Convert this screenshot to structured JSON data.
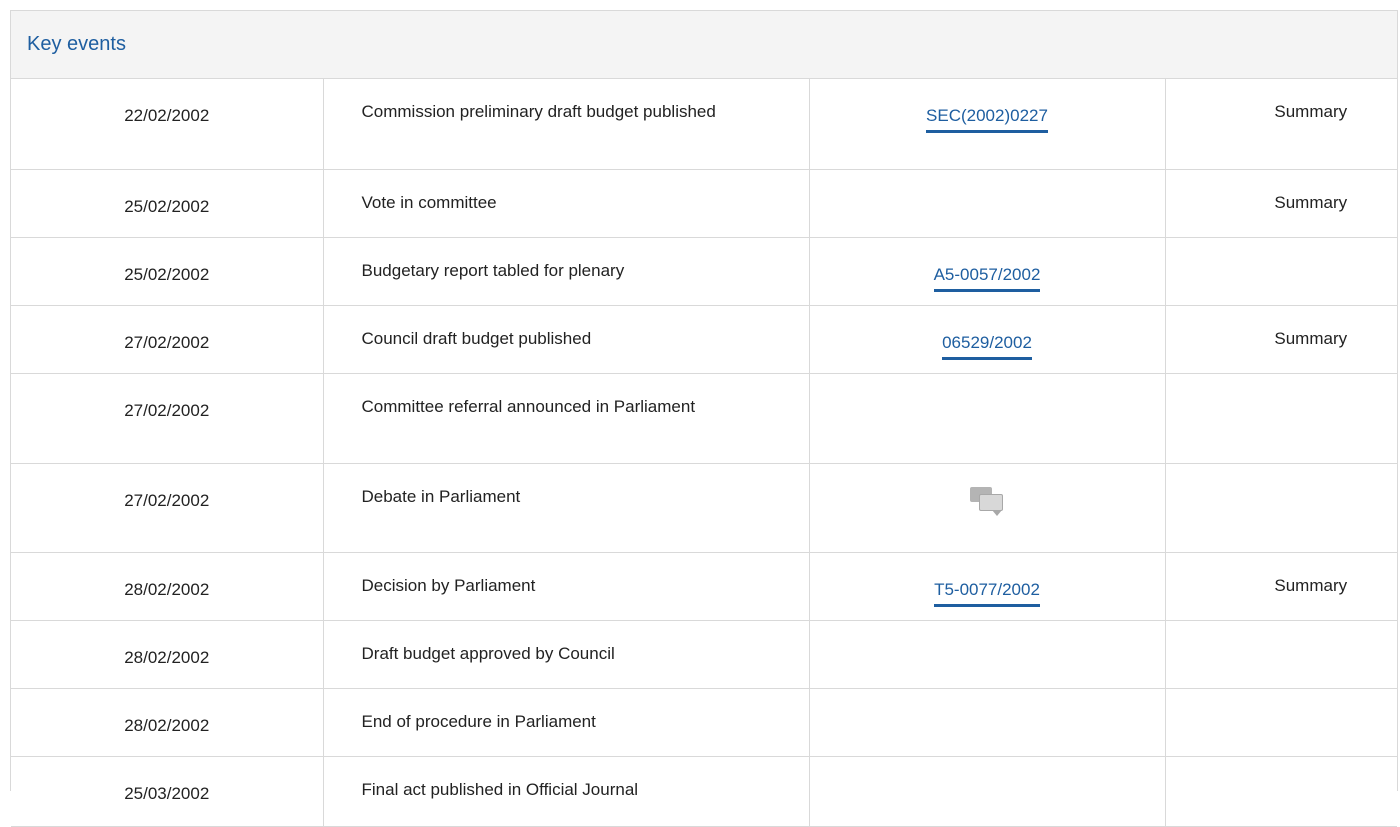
{
  "panel": {
    "title": "Key events"
  },
  "icons": {
    "debate": "debate-speech-bubbles-icon"
  },
  "colors": {
    "link": "#1e5ea0",
    "header_bg": "#f4f4f4",
    "border": "#d9d9d9"
  },
  "events": [
    {
      "date": "22/02/2002",
      "event": "Commission preliminary draft budget published",
      "doc": "SEC(2002)0227",
      "summary": "Summary"
    },
    {
      "date": "25/02/2002",
      "event": "Vote in committee",
      "doc": "",
      "summary": "Summary"
    },
    {
      "date": "25/02/2002",
      "event": "Budgetary report tabled for plenary",
      "doc": "A5-0057/2002",
      "summary": ""
    },
    {
      "date": "27/02/2002",
      "event": "Council draft budget published",
      "doc": "06529/2002",
      "summary": "Summary"
    },
    {
      "date": "27/02/2002",
      "event": "Committee referral announced in Parliament",
      "doc": "",
      "summary": ""
    },
    {
      "date": "27/02/2002",
      "event": "Debate in Parliament",
      "doc": "",
      "summary": ""
    },
    {
      "date": "28/02/2002",
      "event": "Decision by Parliament",
      "doc": "T5-0077/2002",
      "summary": "Summary"
    },
    {
      "date": "28/02/2002",
      "event": "Draft budget approved by Council",
      "doc": "",
      "summary": ""
    },
    {
      "date": "28/02/2002",
      "event": "End of procedure in Parliament",
      "doc": "",
      "summary": ""
    },
    {
      "date": "25/03/2002",
      "event": "Final act published in Official Journal",
      "doc": "",
      "summary": ""
    }
  ]
}
